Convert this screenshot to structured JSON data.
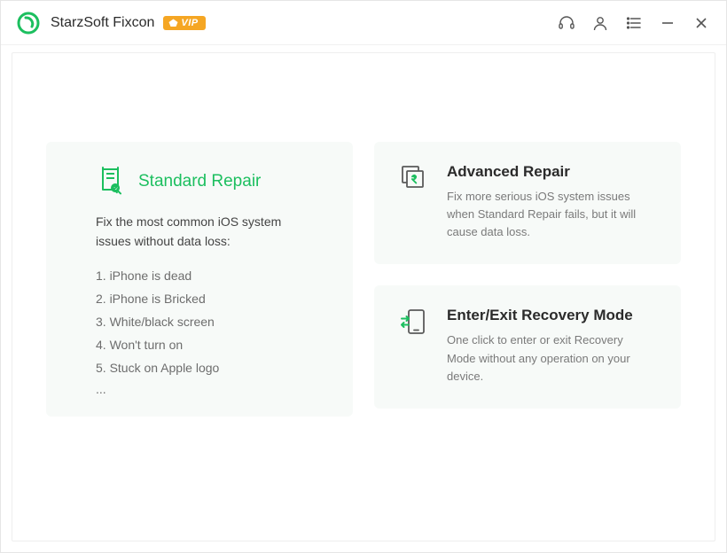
{
  "header": {
    "title": "StarzSoft Fixcon",
    "vip_label": "VIP"
  },
  "cards": {
    "standard": {
      "title": "Standard Repair",
      "subtitle": "Fix the most common iOS system issues without data loss:",
      "items": [
        "1. iPhone is dead",
        "2. iPhone is Bricked",
        "3. White/black screen",
        "4. Won't turn on",
        "5. Stuck on Apple logo"
      ],
      "more": "..."
    },
    "advanced": {
      "title": "Advanced Repair",
      "desc": "Fix more serious iOS system issues when Standard Repair fails, but it will cause data loss."
    },
    "recovery": {
      "title": "Enter/Exit Recovery Mode",
      "desc": "One click to enter or exit Recovery Mode without any operation on your device."
    }
  }
}
